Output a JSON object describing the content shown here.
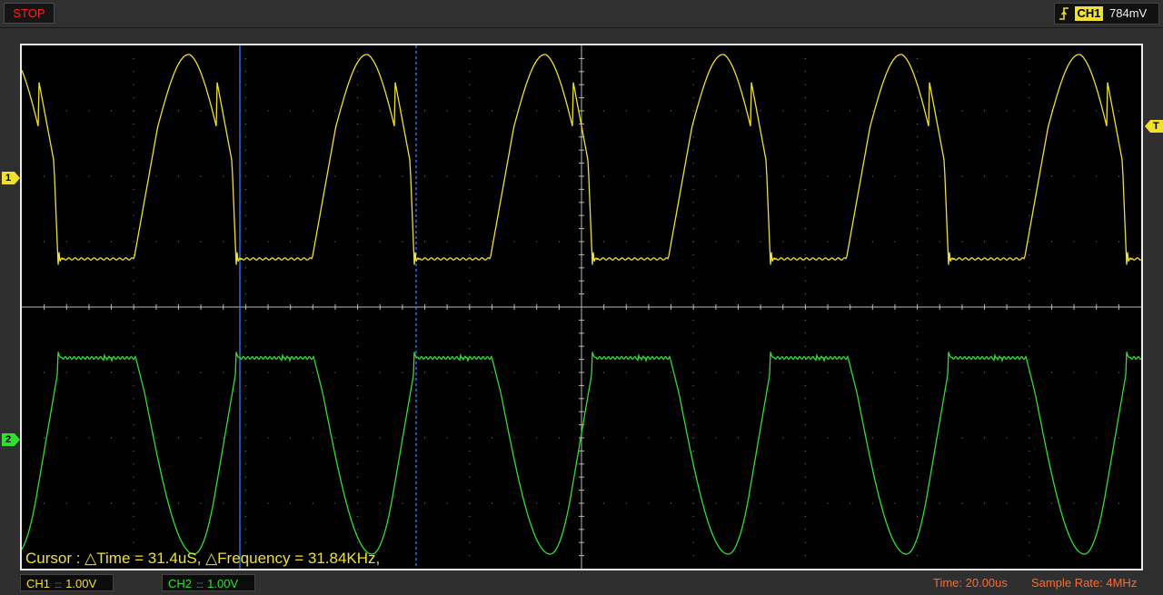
{
  "status": {
    "label": "STOP",
    "color": "#ff2020"
  },
  "trigger": {
    "icon": "rising-edge-icon",
    "channel": "CH1",
    "level": "784mV"
  },
  "markers": {
    "ch1": "1",
    "ch2": "2",
    "trigger": "T"
  },
  "cursor_readout": "Cursor : △Time = 31.4uS, △Frequency = 31.84KHz,",
  "channels": {
    "ch1": {
      "label": "CH1",
      "coupling": "::::",
      "scale": "1.00V",
      "color": "#f0e030"
    },
    "ch2": {
      "label": "CH2",
      "coupling": "::::",
      "scale": "1.00V",
      "color": "#30e030"
    }
  },
  "timebase": {
    "label": "Time: 20.00us"
  },
  "sample_rate": {
    "label": "Sample Rate: 4MHz"
  },
  "colors": {
    "cursor": "#3a8cff",
    "grid": "#8a8a8a",
    "accent_info": "#ff6a2a"
  }
}
